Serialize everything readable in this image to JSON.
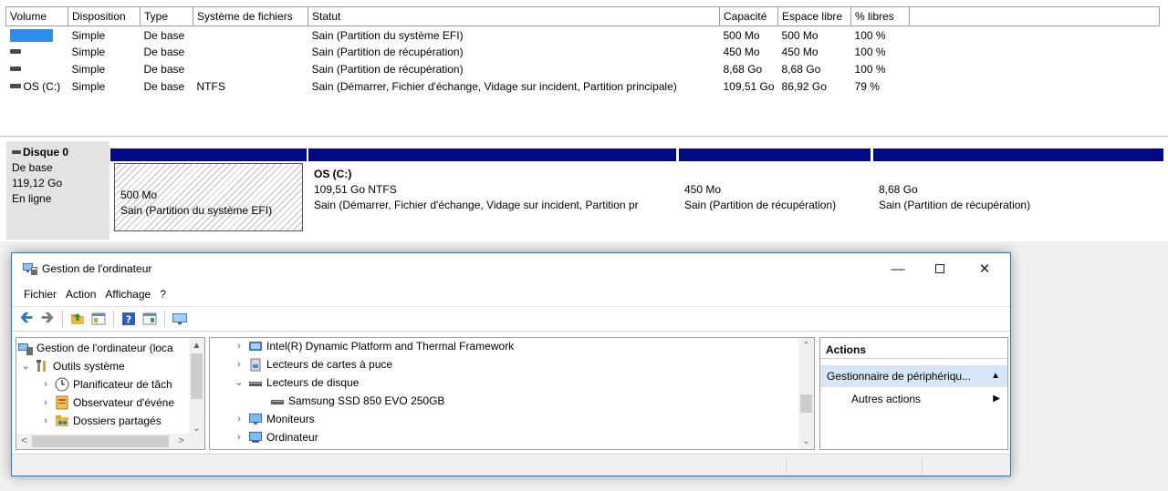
{
  "volumes": {
    "headers": [
      "Volume",
      "Disposition",
      "Type",
      "Système de fichiers",
      "Statut",
      "Capacité",
      "Espace libre",
      "% libres"
    ],
    "rows": [
      {
        "volume": "",
        "disposition": "Simple",
        "type": "De base",
        "fs": "",
        "status": "Sain (Partition du système EFI)",
        "capacity": "500 Mo",
        "free": "500 Mo",
        "pct": "100 %"
      },
      {
        "volume": "",
        "disposition": "Simple",
        "type": "De base",
        "fs": "",
        "status": "Sain (Partition de récupération)",
        "capacity": "450 Mo",
        "free": "450 Mo",
        "pct": "100 %"
      },
      {
        "volume": "",
        "disposition": "Simple",
        "type": "De base",
        "fs": "",
        "status": "Sain (Partition de récupération)",
        "capacity": "8,68 Go",
        "free": "8,68 Go",
        "pct": "100 %"
      },
      {
        "volume": "OS (C:)",
        "disposition": "Simple",
        "type": "De base",
        "fs": "NTFS",
        "status": "Sain (Démarrer, Fichier d'échange, Vidage sur incident, Partition principale)",
        "capacity": "109,51 Go",
        "free": "86,92 Go",
        "pct": "79 %"
      }
    ]
  },
  "disk": {
    "name": "Disque 0",
    "type": "De base",
    "size": "119,12 Go",
    "state": "En ligne",
    "partitions": [
      {
        "name": "",
        "size": "500 Mo",
        "status": "Sain (Partition du système EFI)"
      },
      {
        "name": "OS  (C:)",
        "size": "109,51 Go NTFS",
        "status": "Sain (Démarrer, Fichier d'échange, Vidage sur incident, Partition pr"
      },
      {
        "name": "",
        "size": "450 Mo",
        "status": "Sain (Partition de récupération)"
      },
      {
        "name": "",
        "size": "8,68 Go",
        "status": "Sain (Partition de récupération)"
      }
    ]
  },
  "window": {
    "title": "Gestion de l'ordinateur",
    "menu": [
      "Fichier",
      "Action",
      "Affichage",
      "?"
    ],
    "tree": [
      {
        "label": "Gestion de l'ordinateur (loca",
        "icon": "computer-management-icon"
      },
      {
        "label": "Outils système",
        "icon": "tools-icon"
      },
      {
        "label": "Planificateur de tâch",
        "icon": "clock-icon"
      },
      {
        "label": "Observateur d'événe",
        "icon": "event-viewer-icon"
      },
      {
        "label": "Dossiers partagés",
        "icon": "shared-folder-icon"
      }
    ],
    "devices": [
      {
        "label": "Intel(R) Dynamic Platform and Thermal Framework",
        "icon": "device-icon"
      },
      {
        "label": "Lecteurs de cartes à puce",
        "icon": "smart-card-icon"
      },
      {
        "label": "Lecteurs de disque",
        "icon": "disk-drive-icon"
      },
      {
        "label": "Samsung SSD 850 EVO 250GB",
        "icon": "disk-drive-icon"
      },
      {
        "label": "Moniteurs",
        "icon": "monitor-icon"
      },
      {
        "label": "Ordinateur",
        "icon": "computer-icon"
      }
    ],
    "actions": {
      "header": "Actions",
      "selected": "Gestionnaire de périphériqu...",
      "more": "Autres actions"
    }
  },
  "colors": {
    "partition_bar": "#000a87",
    "selection": "#d7e6f7",
    "window_border": "#1f7ad6"
  }
}
